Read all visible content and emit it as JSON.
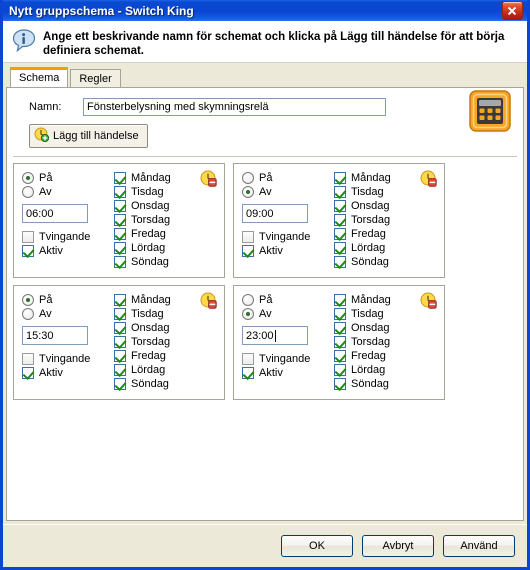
{
  "window": {
    "title": "Nytt gruppschema - Switch King",
    "close_label": "x"
  },
  "banner": {
    "icon": "info-icon",
    "text": "Ange ett beskrivande namn för schemat och klicka på Lägg till händelse för att börja definiera schemat."
  },
  "tabs": [
    {
      "label": "Schema",
      "active": true
    },
    {
      "label": "Regler",
      "active": false
    }
  ],
  "form": {
    "name_label": "Namn:",
    "name_value": "Fönsterbelysning med skymningsrelä",
    "name_placeholder": "",
    "calculator_icon": "calculator-icon",
    "add_event_label": "Lägg till händelse",
    "add_event_icon": "clock-add-icon"
  },
  "event_common": {
    "on_label": "På",
    "off_label": "Av",
    "forced_label": "Tvingande",
    "active_label": "Aktiv",
    "days": [
      "Måndag",
      "Tisdag",
      "Onsdag",
      "Torsdag",
      "Fredag",
      "Lördag",
      "Söndag"
    ],
    "delete_icon": "clock-delete-icon"
  },
  "events": [
    {
      "mode": "on",
      "time": "06:00",
      "focused": false,
      "forced": false,
      "active": true,
      "days_checked": [
        true,
        true,
        true,
        true,
        true,
        true,
        true
      ]
    },
    {
      "mode": "off",
      "time": "09:00",
      "focused": false,
      "forced": false,
      "active": true,
      "days_checked": [
        true,
        true,
        true,
        true,
        true,
        true,
        true
      ]
    },
    {
      "mode": "on",
      "time": "15:30",
      "focused": false,
      "forced": false,
      "active": true,
      "days_checked": [
        true,
        true,
        true,
        true,
        true,
        true,
        true
      ]
    },
    {
      "mode": "off",
      "time": "23:00",
      "focused": true,
      "forced": false,
      "active": true,
      "days_checked": [
        true,
        true,
        true,
        true,
        true,
        true,
        true
      ]
    }
  ],
  "footer": {
    "ok_label": "OK",
    "cancel_label": "Avbryt",
    "apply_label": "Använd"
  },
  "colors": {
    "titlebar_blue": "#0a46d2",
    "accent_orange": "#f0a000",
    "dialog_beige": "#ece9d8",
    "check_green": "#1a8a1a",
    "close_red": "#c6301a"
  }
}
